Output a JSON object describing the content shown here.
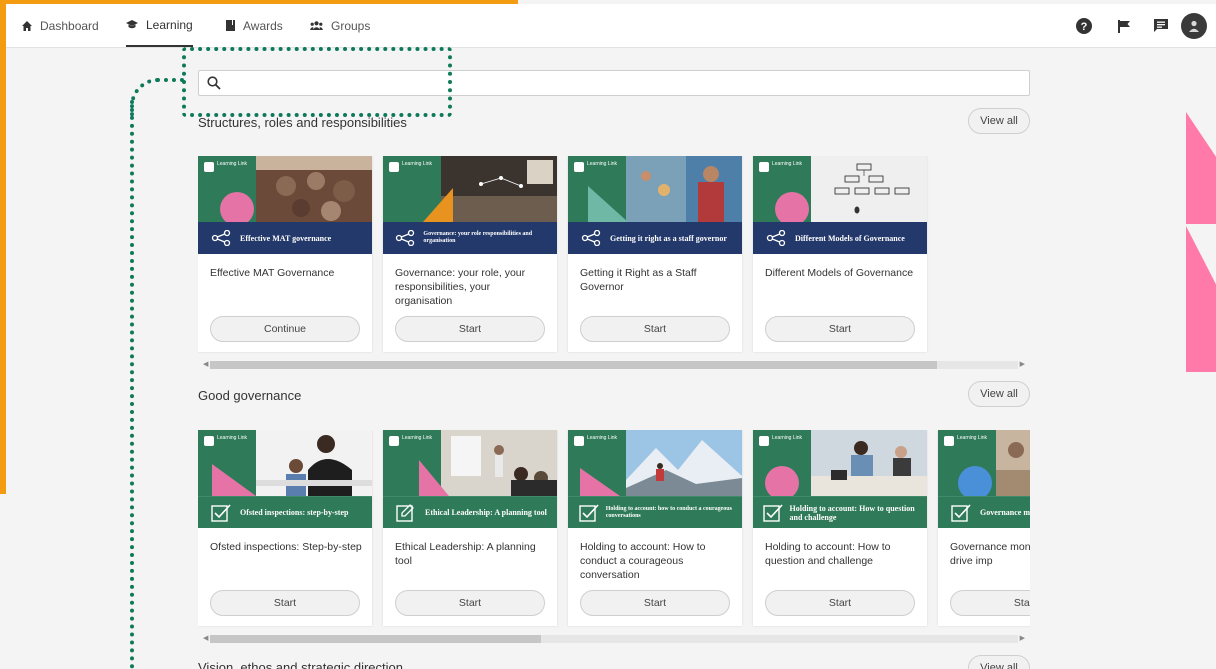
{
  "nav": {
    "items": [
      {
        "label": "Dashboard",
        "icon": "home-icon"
      },
      {
        "label": "Learning",
        "icon": "graduation-cap-icon"
      },
      {
        "label": "Awards",
        "icon": "book-icon"
      },
      {
        "label": "Groups",
        "icon": "group-icon"
      }
    ],
    "active": "Learning",
    "right_icons": [
      "help-icon",
      "flag-icon",
      "chat-icon",
      "user-avatar-icon"
    ]
  },
  "search": {
    "placeholder": "",
    "value": ""
  },
  "sections": [
    {
      "title": "Structures, roles and responsibilities",
      "view_all": "View all",
      "cards": [
        {
          "thumb_text": "Effective MAT governance",
          "title": "Effective MAT Governance",
          "button": "Continue"
        },
        {
          "thumb_text": "Governance: your role responsibilities and organisation",
          "title": "Governance: your role, your responsibilities, your organisation",
          "button": "Start"
        },
        {
          "thumb_text": "Getting it right as a staff governor",
          "title": "Getting it Right as a Staff Governor",
          "button": "Start"
        },
        {
          "thumb_text": "Different Models of Governance",
          "title": "Different Models of Governance",
          "button": "Start"
        }
      ]
    },
    {
      "title": "Good governance",
      "view_all": "View all",
      "cards": [
        {
          "thumb_text": "Ofsted inspections: step-by-step",
          "title": "Ofsted inspections: Step-by-step",
          "button": "Start"
        },
        {
          "thumb_text": "Ethical Leadership: A planning tool",
          "title": "Ethical Leadership: A planning tool",
          "button": "Start"
        },
        {
          "thumb_text": "Holding to account: how to conduct a courageous conversations",
          "title": "Holding to account: How to conduct a courageous conversation",
          "button": "Start"
        },
        {
          "thumb_text": "Holding to account: How to question and challenge",
          "title": "Holding to account: How to question and challenge",
          "button": "Start"
        },
        {
          "thumb_text": "Governance monitoring tool to help d",
          "title": "Governance monitoring to help drive imp",
          "button": "Start"
        }
      ]
    },
    {
      "title": "Vision, ethos and strategic direction",
      "view_all": "View all"
    }
  ],
  "logo_text": "Learning Link",
  "colors": {
    "accent_orange": "#f39c12",
    "accent_pink": "#ff7aa8",
    "dotted_green": "#0e7a5a",
    "navy_band": "#24396b",
    "green_band": "#2f7a58"
  },
  "scrollbars": [
    {
      "section": 1,
      "visible_fraction": 0.9
    },
    {
      "section": 2,
      "visible_fraction": 0.41
    }
  ]
}
